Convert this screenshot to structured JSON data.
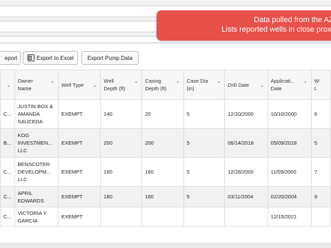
{
  "toast": {
    "line1": "Data pulled from the AZ We",
    "line2": "Lists reported wells in close proximity"
  },
  "toolbar": {
    "report_label": "eport",
    "excel_label": "Export to Excel",
    "pump_label": "Export Pump Data"
  },
  "table": {
    "headers": [
      "",
      "Owner Name",
      "Well Type",
      "Well Depth (ft)",
      "Casing Depth (ft)",
      "Case Dia (in)",
      "Drill Date",
      "Applicati... Date",
      "W L"
    ],
    "header_lines": [
      [
        ""
      ],
      [
        "Owner",
        "Name"
      ],
      [
        "Well Type"
      ],
      [
        "Well",
        "Depth (ft)"
      ],
      [
        "Casing",
        "Depth (ft)"
      ],
      [
        "Case Dia",
        "(in)"
      ],
      [
        "Drill Date"
      ],
      [
        "Applicati...",
        "Date"
      ],
      [
        "W",
        "L"
      ]
    ],
    "rows": [
      {
        "c0": "C...",
        "owner": [
          "JUSTIN BOX &",
          "AMANDA",
          "SAUCEDA"
        ],
        "type": "EXEMPT",
        "depth": "140",
        "casing": "20",
        "dia": "5",
        "drill": "12/20/2000",
        "app": "10/10/2000",
        "last": "6"
      },
      {
        "c0": "B...",
        "owner": [
          "KOG",
          "INVESTMEN...",
          "LLC"
        ],
        "type": "EXEMPT",
        "depth": "200",
        "casing": "200",
        "dia": "5",
        "drill": "06/14/2018",
        "app": "05/09/2018",
        "last": "5"
      },
      {
        "c0": "C...",
        "owner": [
          "BENSCOTER",
          "DEVELOPM...",
          "LLC"
        ],
        "type": "EXEMPT",
        "depth": "160",
        "casing": "160",
        "dia": "5",
        "drill": "12/28/2000",
        "app": "11/09/2000",
        "last": "7"
      },
      {
        "c0": "C...",
        "owner": [
          "APRIL",
          "EDWARDS"
        ],
        "type": "EXEMPT",
        "depth": "180",
        "casing": "180",
        "dia": "5",
        "drill": "03/11/2004",
        "app": "02/20/2004",
        "last": "9"
      },
      {
        "c0": "C...",
        "owner": [
          "VICTORIA Y",
          "GARCIA"
        ],
        "type": "EXEMPT",
        "depth": "",
        "casing": "",
        "dia": "",
        "drill": "",
        "app": "12/15/2021",
        "last": ""
      }
    ]
  }
}
